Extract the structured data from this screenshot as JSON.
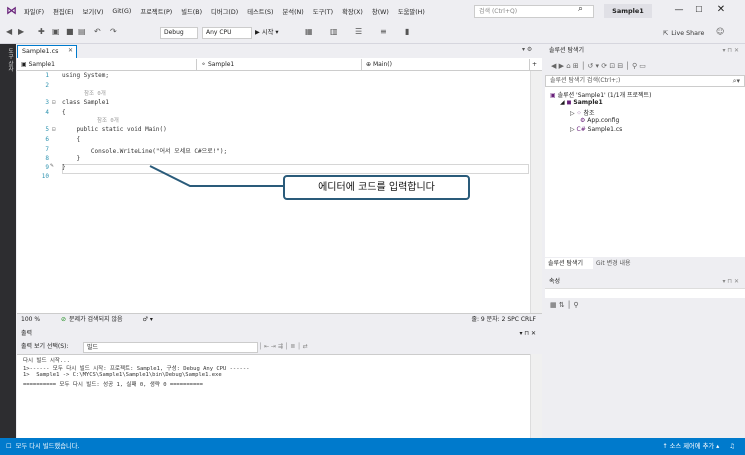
{
  "menu": {
    "logo": "⋈",
    "items": [
      "파일(F)",
      "편집(E)",
      "보기(V)",
      "Git(G)",
      "프로젝트(P)",
      "빌드(B)",
      "디버그(D)",
      "테스트(S)",
      "분석(N)",
      "도구(T)",
      "확장(X)",
      "창(W)",
      "도움말(H)"
    ],
    "search_placeholder": "검색 (Ctrl+Q)",
    "solution_name": "Sample1",
    "minimize": "—",
    "maximize": "☐",
    "close": "✕"
  },
  "toolbar": {
    "config": "Debug",
    "platform": "Any CPU",
    "start_label": "▶ 시작 ▾",
    "live_share": "Live Share"
  },
  "left_strip": {
    "label": "도구 상자"
  },
  "editor": {
    "tab_name": "Sample1.cs",
    "tab_close": "✕",
    "nav_project": "Sample1",
    "nav_class": "Sample1",
    "nav_member": "Main()",
    "lines": [
      {
        "n": "1",
        "code": "using System;"
      },
      {
        "n": "2",
        "code": ""
      },
      {
        "n": "3",
        "code": "class Sample1"
      },
      {
        "n": "4",
        "code": "{"
      },
      {
        "n": "5",
        "code": "    public static void Main()"
      },
      {
        "n": "6",
        "code": "    {"
      },
      {
        "n": "7",
        "code": "        Console.WriteLine(\"어서 오세요 C#으로!\");"
      },
      {
        "n": "8",
        "code": "    }"
      },
      {
        "n": "9",
        "code": "}"
      },
      {
        "n": "10",
        "code": ""
      }
    ],
    "ref_class": "참조 0개",
    "ref_method": "참조 0개",
    "zoom": "100 %",
    "issues": "문제가 검색되지 않음",
    "cursor": "줄: 9   문자: 2   SPC   CRLF"
  },
  "callout": {
    "text": "에디터에 코드를 입력합니다"
  },
  "output": {
    "title": "출력",
    "source_label": "출력 보기 선택(S):",
    "source_value": "빌드",
    "lines": [
      "다시 빌드 시작...",
      "1>------ 모두 다시 빌드 시작: 프로젝트: Sample1, 구성: Debug Any CPU ------",
      "1>  Sample1 -> C:\\MYCS\\Sample1\\Sample1\\bin\\Debug\\Sample1.exe",
      "========== 모두 다시 빌드: 성공 1, 실패 0, 생략 0 =========="
    ]
  },
  "solution_explorer": {
    "title": "솔루션 탐색기",
    "search_placeholder": "솔루션 탐색기 검색(Ctrl+;)",
    "tree": [
      {
        "label": "솔루션 'Sample1' (1/1개 프로젝트)",
        "indent": 0,
        "bold": false
      },
      {
        "label": "Sample1",
        "indent": 1,
        "bold": true
      },
      {
        "label": "참조",
        "indent": 2,
        "bold": false
      },
      {
        "label": "App.config",
        "indent": 3,
        "bold": false
      },
      {
        "label": "Sample1.cs",
        "indent": 2,
        "bold": false
      }
    ],
    "tab_active": "솔루션 탐색기",
    "tab_other": "Git 변경 내용"
  },
  "properties": {
    "title": "속성"
  },
  "statusbar": {
    "message": "모두 다시 빌드했습니다.",
    "source_control": "↑ 소스 제어에 추가 ▴"
  },
  "colors": {
    "accent": "#007acc",
    "callout_border": "#2a5b7a",
    "line_number": "#2b91af"
  }
}
